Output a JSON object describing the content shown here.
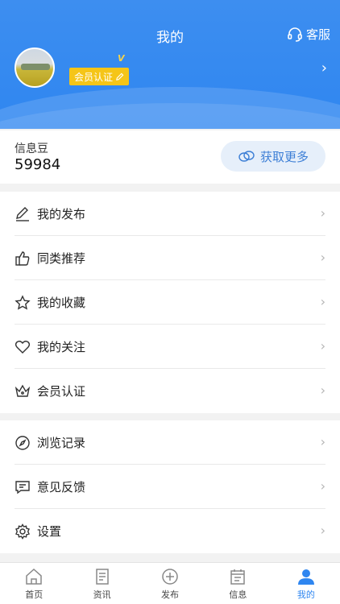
{
  "header": {
    "title": "我的",
    "service_label": "客服",
    "vip_label": "V",
    "badge_label": "会员认证"
  },
  "beans": {
    "label": "信息豆",
    "value": "59984",
    "get_more": "获取更多"
  },
  "menu_group_1": [
    {
      "label": "我的发布",
      "icon": "edit-icon"
    },
    {
      "label": "同类推荐",
      "icon": "thumbs-up-icon"
    },
    {
      "label": "我的收藏",
      "icon": "star-icon"
    },
    {
      "label": "我的关注",
      "icon": "heart-icon"
    },
    {
      "label": "会员认证",
      "icon": "crown-icon"
    }
  ],
  "menu_group_2": [
    {
      "label": "浏览记录",
      "icon": "compass-icon"
    },
    {
      "label": "意见反馈",
      "icon": "feedback-icon"
    },
    {
      "label": "设置",
      "icon": "gear-icon"
    }
  ],
  "tabs": [
    {
      "label": "首页",
      "icon": "home-icon"
    },
    {
      "label": "资讯",
      "icon": "news-icon"
    },
    {
      "label": "发布",
      "icon": "plus-circle-icon"
    },
    {
      "label": "信息",
      "icon": "calendar-icon"
    },
    {
      "label": "我的",
      "icon": "user-icon",
      "active": true
    }
  ],
  "colors": {
    "brand_blue": "#2f86f0",
    "badge_yellow": "#f5c518",
    "get_more_bg": "#e6effa"
  }
}
